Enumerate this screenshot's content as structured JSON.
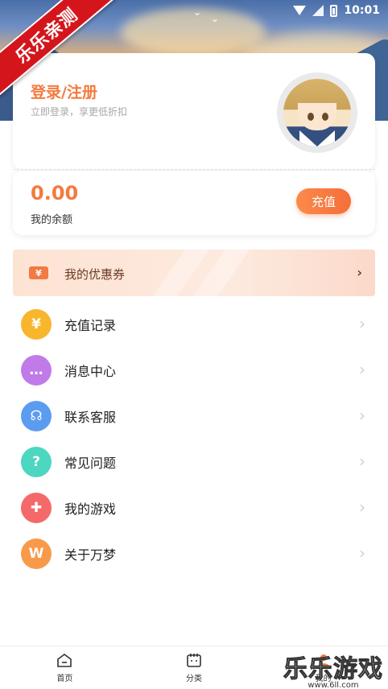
{
  "status_bar": {
    "time": "10:01"
  },
  "ribbon": {
    "text": "乐乐亲测"
  },
  "profile": {
    "login_title": "登录/注册",
    "login_subtitle": "立即登录，享更低折扣"
  },
  "balance": {
    "amount": "0.00",
    "label": "我的余额",
    "recharge_button": "充值"
  },
  "coupon": {
    "icon_text": "¥",
    "label": "我的优惠券"
  },
  "menu": [
    {
      "label": "充值记录",
      "icon": "money-bag-icon",
      "color": "#f8b62d",
      "glyph": "¥"
    },
    {
      "label": "消息中心",
      "icon": "message-icon",
      "color": "#c07be8",
      "glyph": "…"
    },
    {
      "label": "联系客服",
      "icon": "headset-icon",
      "color": "#5b9cf1",
      "glyph": "☊"
    },
    {
      "label": "常见问题",
      "icon": "question-icon",
      "color": "#4dd6c0",
      "glyph": "?"
    },
    {
      "label": "我的游戏",
      "icon": "gamepad-icon",
      "color": "#f46a6a",
      "glyph": "✚"
    },
    {
      "label": "关于万梦",
      "icon": "brand-logo-icon",
      "color": "#f89a4a",
      "glyph": "W"
    }
  ],
  "bottom_nav": [
    {
      "label": "首页",
      "icon": "home-icon"
    },
    {
      "label": "分类",
      "icon": "category-icon"
    },
    {
      "label": "我的",
      "icon": "profile-icon"
    }
  ],
  "watermark": {
    "title": "乐乐游戏",
    "url": "www.6ll.com"
  },
  "colors": {
    "accent": "#f47a3e",
    "ribbon": "#d4161c"
  }
}
